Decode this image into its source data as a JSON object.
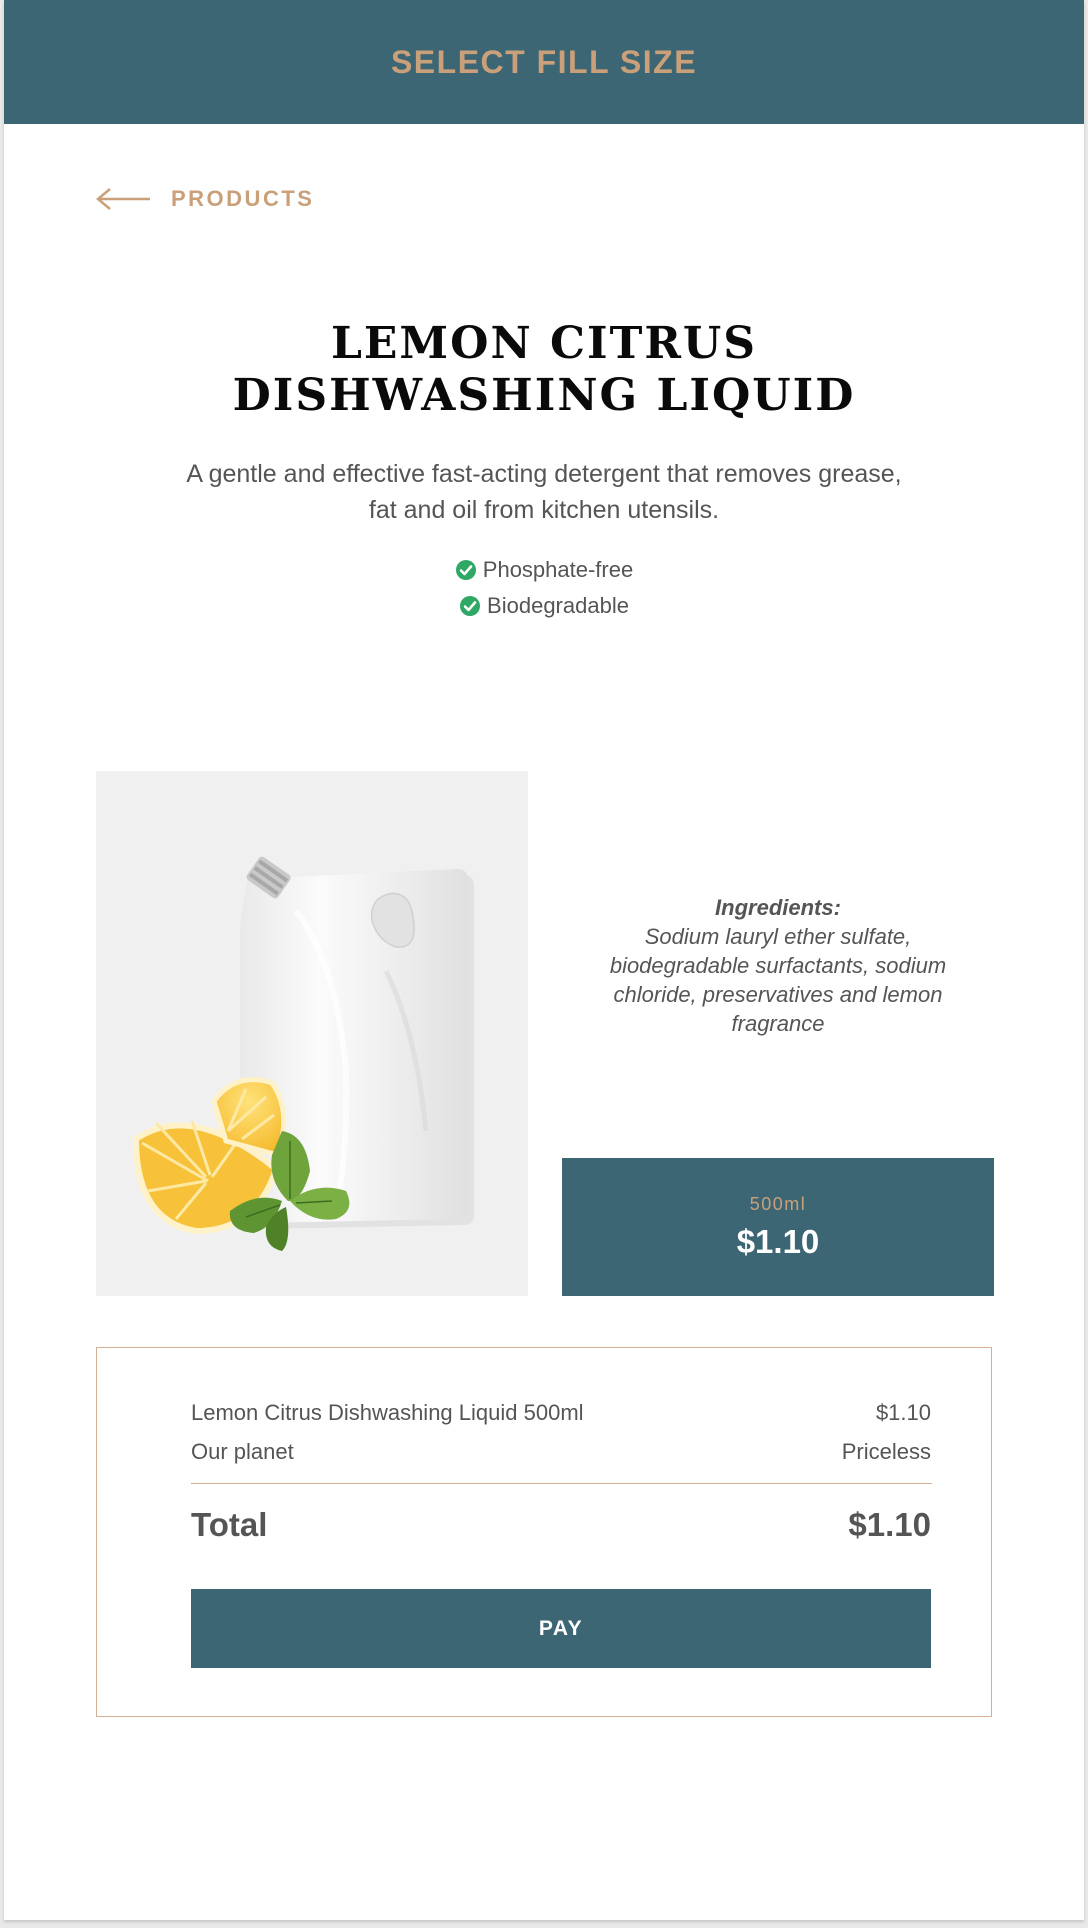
{
  "header": {
    "title": "SELECT FILL SIZE"
  },
  "nav": {
    "back_label": "PRODUCTS",
    "back_icon": "arrow-left-icon"
  },
  "product": {
    "title_line1": "LEMON CITRUS",
    "title_line2": "DISHWASHING LIQUID",
    "description": "A gentle and effective fast-acting detergent that removes grease, fat and oil from kitchen utensils.",
    "features": [
      {
        "label": "Phosphate-free",
        "icon": "check-circle-icon"
      },
      {
        "label": "Biodegradable",
        "icon": "check-circle-icon"
      }
    ],
    "ingredients_heading": "Ingredients:",
    "ingredients_text": "Sodium lauryl ether sulfate, biodegradable surfactants, sodium chloride, preservatives and lemon fragrance"
  },
  "size_option": {
    "size": "500ml",
    "price": "$1.10"
  },
  "summary": {
    "items": [
      {
        "name": "Lemon Citrus Dishwashing Liquid 500ml",
        "price": "$1.10"
      },
      {
        "name": "Our planet",
        "price": "Priceless"
      }
    ],
    "total_label": "Total",
    "total_value": "$1.10",
    "pay_label": "PAY"
  },
  "colors": {
    "primary": "#3d6674",
    "accent": "#c9a07a",
    "check_green": "#2fa866",
    "border": "#d3b095"
  }
}
